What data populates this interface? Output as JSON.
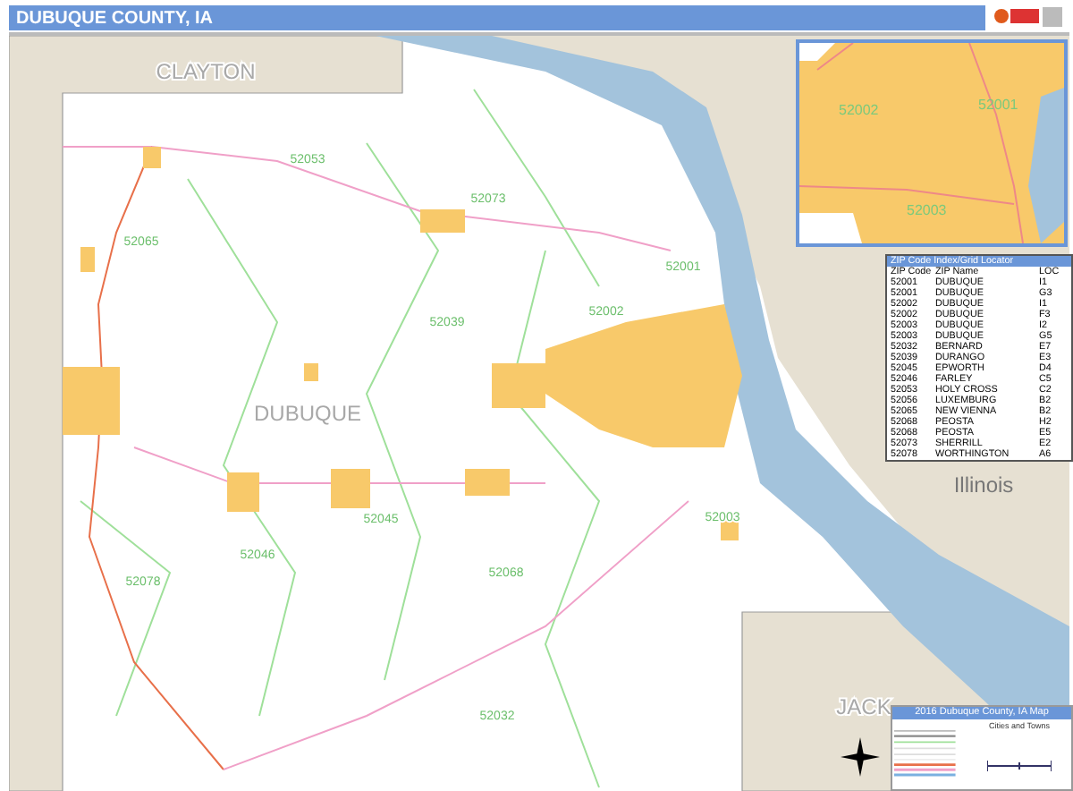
{
  "header": {
    "title": "DUBUQUE COUNTY, IA"
  },
  "map": {
    "county_labels": [
      "CLAYTON",
      "DUBUQUE",
      "JACK"
    ],
    "state_labels": [
      "Illinois"
    ],
    "zip_labels": [
      "52053",
      "52073",
      "52065",
      "52001",
      "52002",
      "52039",
      "52045",
      "52046",
      "52078",
      "52068",
      "52003",
      "52032"
    ]
  },
  "inset": {
    "zip_labels": [
      "52002",
      "52001",
      "52003"
    ]
  },
  "index": {
    "title": "ZIP Code Index/Grid Locator",
    "columns": [
      "ZIP Code",
      "ZIP Name",
      "LOC"
    ],
    "rows": [
      [
        "52001",
        "DUBUQUE",
        "I1"
      ],
      [
        "52001",
        "DUBUQUE",
        "G3"
      ],
      [
        "52002",
        "DUBUQUE",
        "I1"
      ],
      [
        "52002",
        "DUBUQUE",
        "F3"
      ],
      [
        "52003",
        "DUBUQUE",
        "I2"
      ],
      [
        "52003",
        "DUBUQUE",
        "G5"
      ],
      [
        "52032",
        "BERNARD",
        "E7"
      ],
      [
        "52039",
        "DURANGO",
        "E3"
      ],
      [
        "52045",
        "EPWORTH",
        "D4"
      ],
      [
        "52046",
        "FARLEY",
        "C5"
      ],
      [
        "52053",
        "HOLY CROSS",
        "C2"
      ],
      [
        "52056",
        "LUXEMBURG",
        "B2"
      ],
      [
        "52065",
        "NEW VIENNA",
        "B2"
      ],
      [
        "52068",
        "PEOSTA",
        "H2"
      ],
      [
        "52068",
        "PEOSTA",
        "E5"
      ],
      [
        "52073",
        "SHERRILL",
        "E2"
      ],
      [
        "52078",
        "WORTHINGTON",
        "A6"
      ]
    ]
  },
  "legend": {
    "title": "2016 Dubuque County, IA Map",
    "subtitle": "Cities and Towns"
  }
}
